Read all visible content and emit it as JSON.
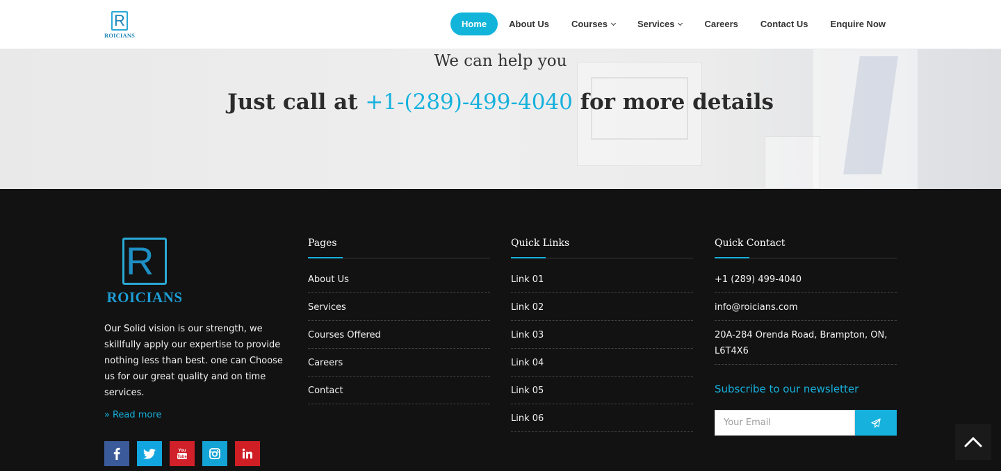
{
  "brand": {
    "name": "ROICIANS",
    "logo_letter": "R"
  },
  "nav": {
    "items": [
      {
        "label": "Home",
        "active": true,
        "dropdown": false
      },
      {
        "label": "About Us",
        "active": false,
        "dropdown": false
      },
      {
        "label": "Courses",
        "active": false,
        "dropdown": true
      },
      {
        "label": "Services",
        "active": false,
        "dropdown": true
      },
      {
        "label": "Careers",
        "active": false,
        "dropdown": false
      },
      {
        "label": "Contact Us",
        "active": false,
        "dropdown": false
      },
      {
        "label": "Enquire Now",
        "active": false,
        "dropdown": false
      }
    ]
  },
  "hero": {
    "subtitle": "We can help you",
    "title_prefix": "Just call at",
    "phone": "+1-(289)-499-4040",
    "title_suffix": "for more details"
  },
  "footer": {
    "about_text": "Our Solid vision is our strength, we skillfully apply our expertise to provide nothing less than best. one can Choose us for our great quality and on time services.",
    "read_more": "Read more",
    "socials": [
      "facebook-icon",
      "twitter-icon",
      "youtube-icon",
      "instagram-icon",
      "linkedin-icon"
    ],
    "pages": {
      "title": "Pages",
      "items": [
        "About Us",
        "Services",
        "Courses Offered",
        "Careers",
        "Contact"
      ]
    },
    "quick_links": {
      "title": "Quick Links",
      "items": [
        "Link 01",
        "Link 02",
        "Link 03",
        "Link 04",
        "Link 05",
        "Link 06"
      ]
    },
    "quick_contact": {
      "title": "Quick Contact",
      "phone": "+1 (289) 499-4040",
      "email": "info@roicians.com",
      "address": "20A-284 Orenda Road, Brampton, ON, L6T4X6"
    },
    "newsletter": {
      "title": "Subscribe to our newsletter",
      "placeholder": "Your Email"
    }
  },
  "colors": {
    "accent": "#16b1dd",
    "footer_bg": "#121212"
  }
}
